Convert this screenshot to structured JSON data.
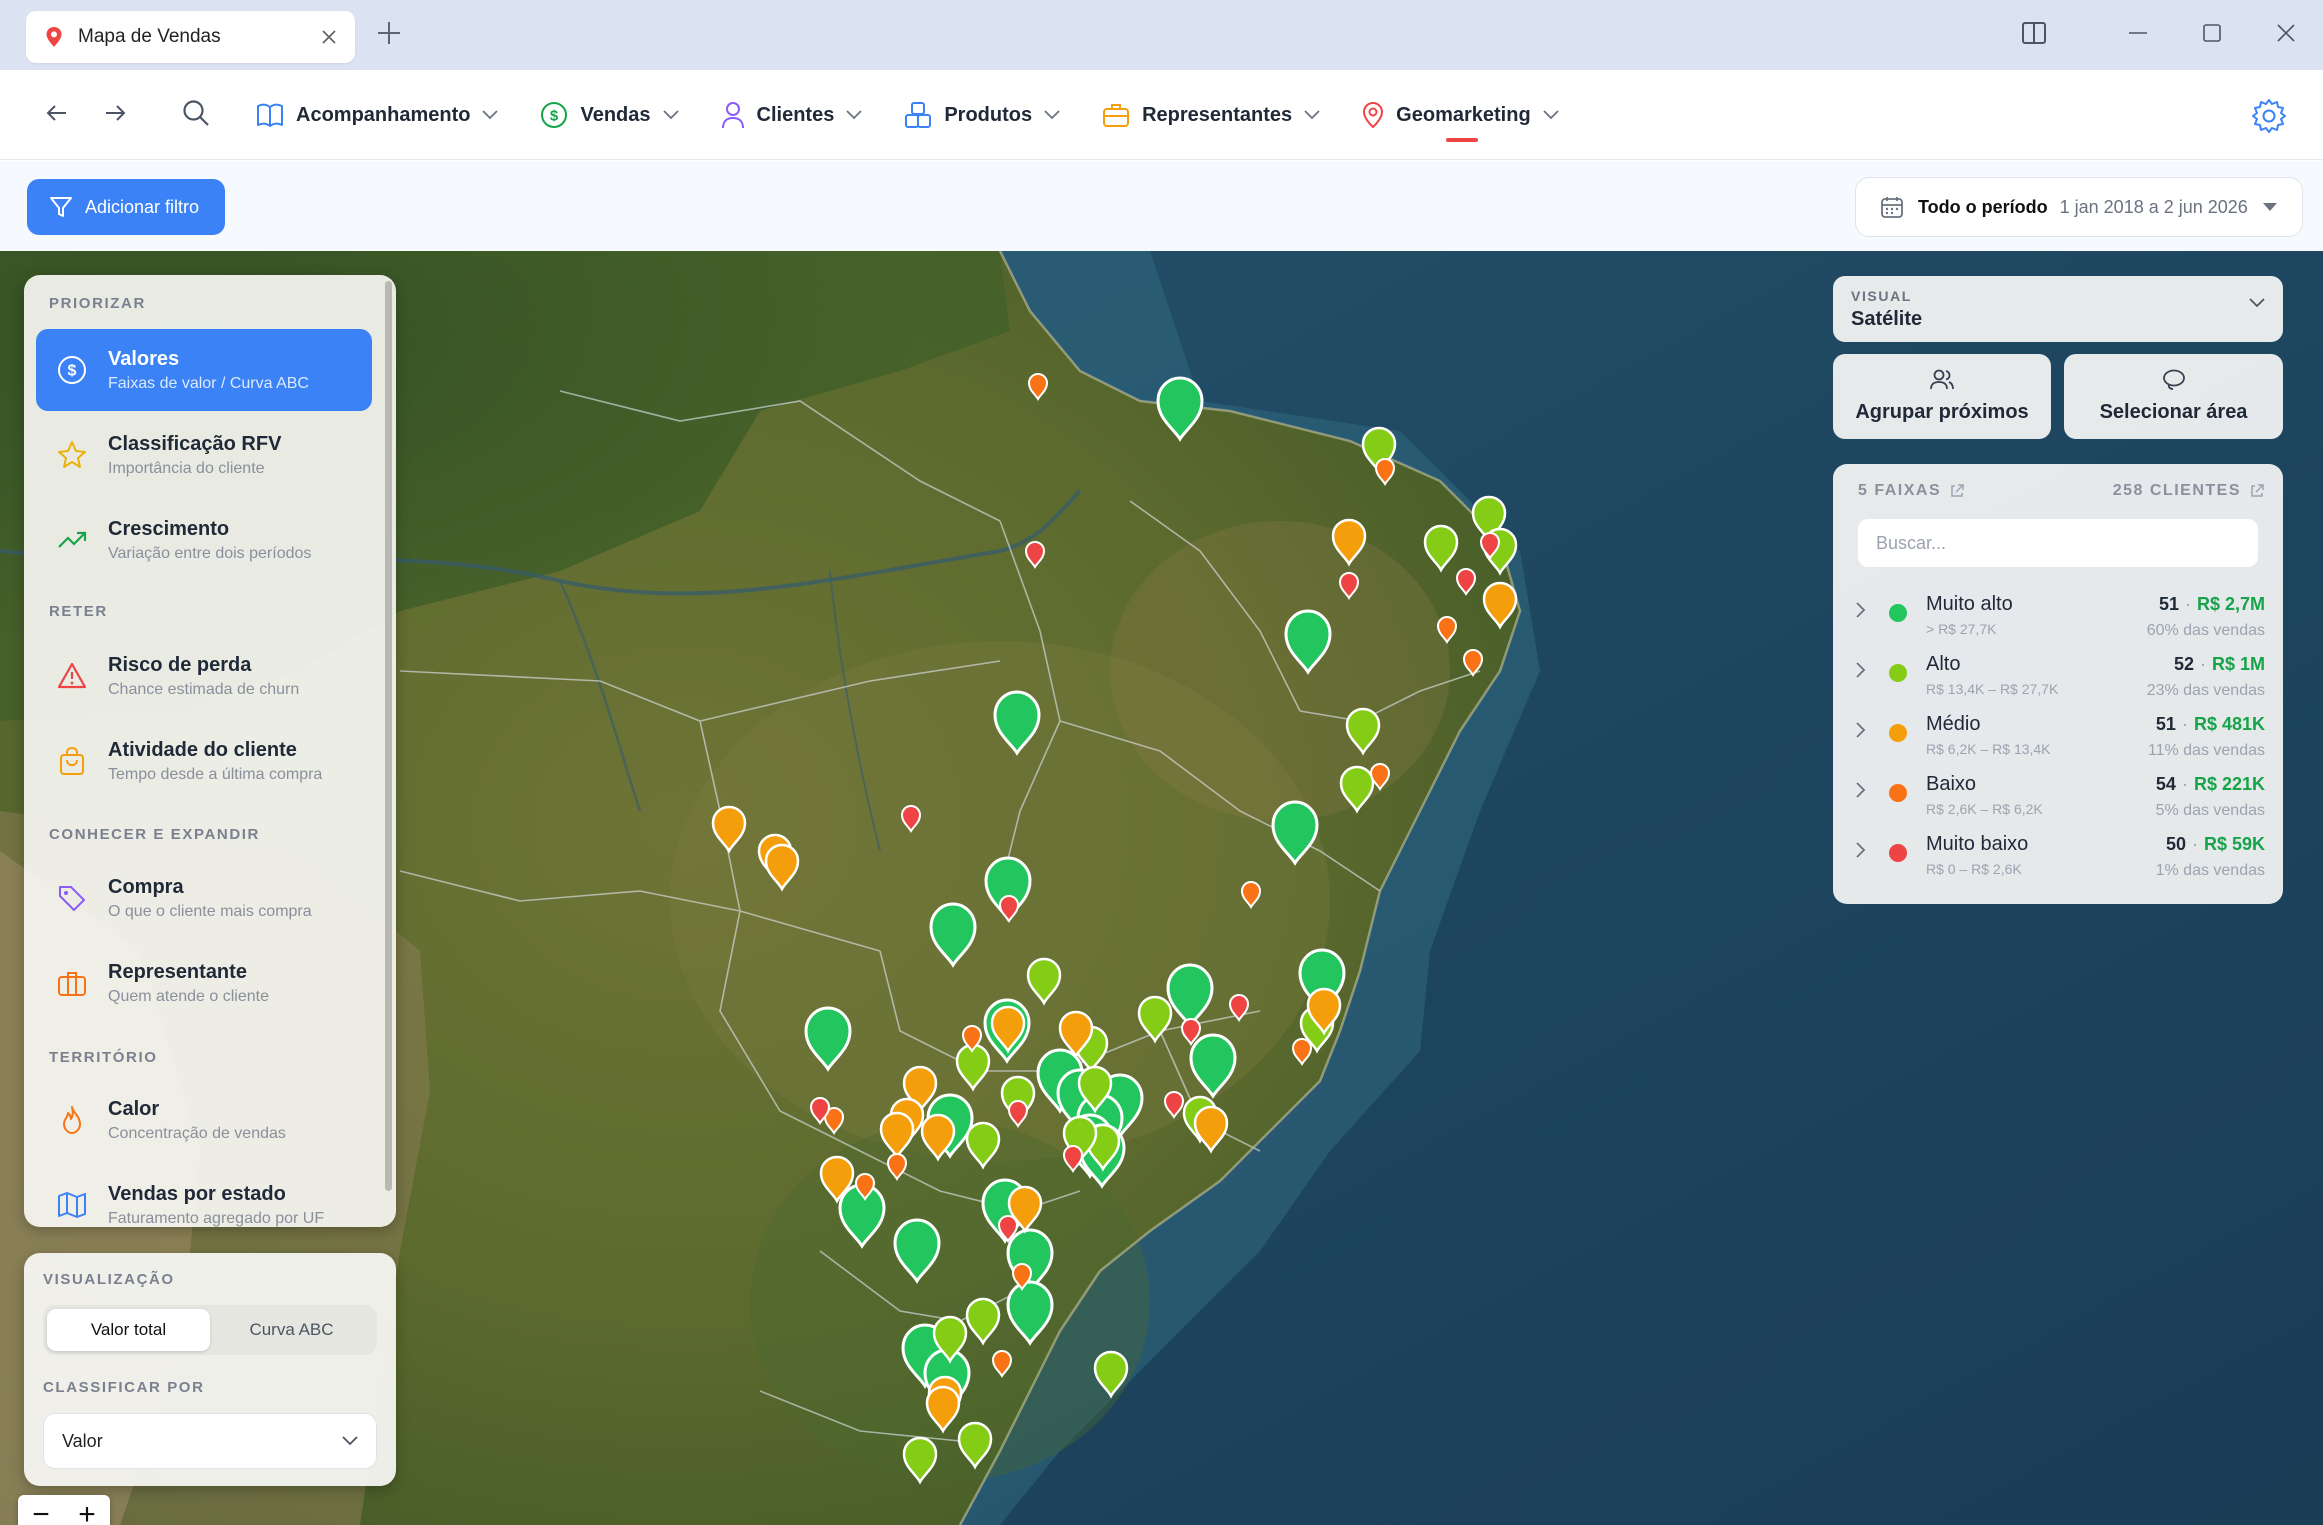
{
  "window": {
    "tab_title": "Mapa de Vendas"
  },
  "nav": {
    "items": [
      {
        "label": "Acompanhamento",
        "icon": "book-open-icon"
      },
      {
        "label": "Vendas",
        "icon": "dollar-circle-icon"
      },
      {
        "label": "Clientes",
        "icon": "user-icon"
      },
      {
        "label": "Produtos",
        "icon": "boxes-icon"
      },
      {
        "label": "Representantes",
        "icon": "briefcase-icon"
      },
      {
        "label": "Geomarketing",
        "icon": "map-pin-icon",
        "active": true
      }
    ]
  },
  "filters": {
    "add_filter_label": "Adicionar filtro",
    "period_label": "Todo o período",
    "period_value": "1 jan 2018 a 2 jun 2026"
  },
  "left_panel": {
    "sections": [
      {
        "title": "PRIORIZAR"
      },
      {
        "title": "RETER"
      },
      {
        "title": "CONHECER E EXPANDIR"
      },
      {
        "title": "TERRITÓRIO"
      }
    ],
    "items": [
      {
        "title": "Valores",
        "subtitle": "Faixas de valor / Curva ABC",
        "icon": "dollar-circle-icon",
        "active": true
      },
      {
        "title": "Classificação RFV",
        "subtitle": "Importância do cliente",
        "icon": "star-icon"
      },
      {
        "title": "Crescimento",
        "subtitle": "Variação entre dois períodos",
        "icon": "trending-up-icon"
      },
      {
        "title": "Risco de perda",
        "subtitle": "Chance estimada de churn",
        "icon": "warning-icon"
      },
      {
        "title": "Atividade do cliente",
        "subtitle": "Tempo desde a última compra",
        "icon": "shopping-bag-icon"
      },
      {
        "title": "Compra",
        "subtitle": "O que o cliente mais compra",
        "icon": "tag-icon"
      },
      {
        "title": "Representante",
        "subtitle": "Quem atende o cliente",
        "icon": "briefcase-icon"
      },
      {
        "title": "Calor",
        "subtitle": "Concentração de vendas",
        "icon": "flame-icon"
      },
      {
        "title": "Vendas por estado",
        "subtitle": "Faturamento agregado por UF",
        "icon": "map-icon"
      }
    ]
  },
  "visualization": {
    "title": "VISUALIZAÇÃO",
    "options": [
      "Valor total",
      "Curva ABC"
    ],
    "selected": "Valor total",
    "sort_title": "CLASSIFICAR POR",
    "sort_value": "Valor"
  },
  "zoom": {
    "minus": "−",
    "plus": "+"
  },
  "right_panel": {
    "visual_label": "VISUAL",
    "visual_value": "Satélite",
    "group_label": "Agrupar próximos",
    "select_area_label": "Selecionar área",
    "bands_label": "5 FAIXAS",
    "clients_label": "258 CLIENTES",
    "search_placeholder": "Buscar...",
    "bands": [
      {
        "name": "Muito alto",
        "range": "> R$ 27,7K",
        "count": "51",
        "value": "R$ 2,7M",
        "share": "60% das vendas",
        "color": "#22c55e"
      },
      {
        "name": "Alto",
        "range": "R$ 13,4K – R$ 27,7K",
        "count": "52",
        "value": "R$ 1M",
        "share": "23% das vendas",
        "color": "#84cc16"
      },
      {
        "name": "Médio",
        "range": "R$ 6,2K – R$ 13,4K",
        "count": "51",
        "value": "R$ 481K",
        "share": "11% das vendas",
        "color": "#f59e0b"
      },
      {
        "name": "Baixo",
        "range": "R$ 2,6K – R$ 6,2K",
        "count": "54",
        "value": "R$ 221K",
        "share": "5% das vendas",
        "color": "#f97316"
      },
      {
        "name": "Muito baixo",
        "range": "R$ 0 – R$ 2,6K",
        "count": "50",
        "value": "R$ 59K",
        "share": "1% das vendas",
        "color": "#ef4444"
      }
    ]
  },
  "colors": {
    "accent": "#3b82f6",
    "active_underline": "#ef4444",
    "money_green": "#16a34a"
  }
}
